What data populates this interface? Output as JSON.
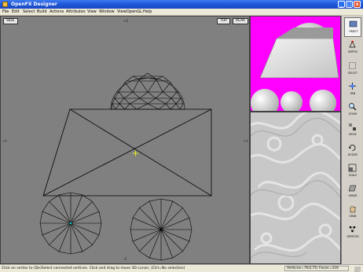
{
  "window": {
    "title": "OpenFX Designer",
    "buttons": {
      "minimize": "_",
      "maximize": "□",
      "close": "x"
    }
  },
  "menu": [
    "File",
    "Edit",
    "Select",
    "Build",
    "Actions",
    "Attributes",
    "View",
    "Window",
    "ViewOpenGL",
    "Help"
  ],
  "viewport": {
    "view_buttons": {
      "side": "SIDE",
      "top": "TOP",
      "rear": "REAR"
    },
    "axis_labels": {
      "top": "+Z",
      "left": "+Y",
      "right": "+Y",
      "bottom": "-Z"
    },
    "background_color": "#808080",
    "wire_color": "#000000",
    "cursor_color": "#ffff00",
    "selected_vertex_color": "#00c0c0"
  },
  "preview": {
    "background_color": "#ff00ff"
  },
  "toolbar": {
    "tools": [
      {
        "label": "OBJECT",
        "icon": "object-icon",
        "active": true
      },
      {
        "label": "VERTEX",
        "icon": "vertex-icon"
      },
      {
        "label": "SELECT",
        "icon": "select-icon"
      },
      {
        "label": "PAN",
        "icon": "pan-icon"
      },
      {
        "label": "ZOOM",
        "icon": "zoom-icon"
      },
      {
        "label": "MOVE",
        "icon": "move-icon"
      },
      {
        "label": "ROTATE",
        "icon": "rotate-icon"
      },
      {
        "label": "SCALE",
        "icon": "scale-icon"
      },
      {
        "label": "SHEAR",
        "icon": "shear-icon"
      },
      {
        "label": "GRAB",
        "icon": "grab-icon"
      },
      {
        "label": "VERTICES",
        "icon": "vertices-icon"
      }
    ]
  },
  "status": {
    "message": "Click on vertex to (De)Select connected vertices. Click and drag to move 3D cursor, (Ctrl=No selection)",
    "counts": "Vertices=76(175) Faces=316"
  }
}
